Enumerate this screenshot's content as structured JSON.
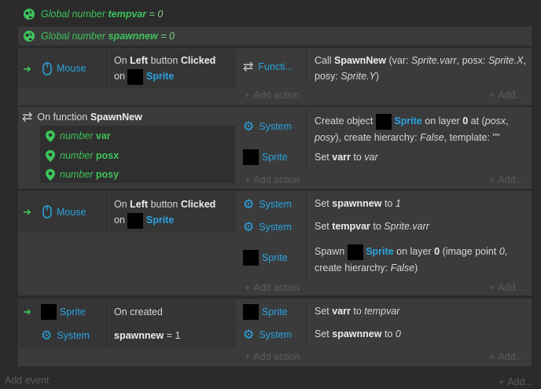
{
  "globals": [
    {
      "prefix": "Global number",
      "name": "tempvar",
      "value": "= 0"
    },
    {
      "prefix": "Global number",
      "name": "spawnnew",
      "value": "= 0"
    }
  ],
  "ev1": {
    "object": "Mouse",
    "cond_on": "On",
    "cond_btn": "Left",
    "cond_mid": "button",
    "cond_click": "Clicked",
    "cond_on2": "on",
    "cond_obj": "Sprite",
    "act_obj": "Functi...",
    "act_call": "Call",
    "act_fn": "SpawnNew",
    "act_args1": "(var:",
    "act_v1": "Sprite.varr",
    "act_args2": ", posx:",
    "act_v2": "Sprite.X",
    "act_args3": ",",
    "act_args4": "posy:",
    "act_v3": "Sprite.Y",
    "act_args5": ")"
  },
  "ev2": {
    "header_prefix": "On function",
    "header_name": "SpawnNew",
    "params": [
      {
        "type": "number",
        "name": "var"
      },
      {
        "type": "number",
        "name": "posx"
      },
      {
        "type": "number",
        "name": "posy"
      }
    ],
    "act1_obj": "System",
    "act1_a": "Create object",
    "act1_b": "Sprite",
    "act1_c": "on layer",
    "act1_d": "0",
    "act1_e": "at (",
    "act1_f": "posx",
    "act1_g": ",",
    "act1_h": "posy",
    "act1_i": "), create hierarchy:",
    "act1_j": "False",
    "act1_k": ", template: \"\"",
    "act2_obj": "Sprite",
    "act2_a": "Set",
    "act2_b": "varr",
    "act2_c": "to",
    "act2_d": "var"
  },
  "ev3": {
    "object": "Mouse",
    "cond_on": "On",
    "cond_btn": "Left",
    "cond_mid": "button",
    "cond_click": "Clicked",
    "cond_on2": "on",
    "cond_obj": "Sprite",
    "act1_obj": "System",
    "act1_a": "Set",
    "act1_b": "spawnnew",
    "act1_c": "to",
    "act1_d": "1",
    "act2_obj": "System",
    "act2_a": "Set",
    "act2_b": "tempvar",
    "act2_c": "to",
    "act2_d": "Sprite.varr",
    "act3_obj": "Sprite",
    "act3_a": "Spawn",
    "act3_b": "Sprite",
    "act3_c": "on layer",
    "act3_d": "0",
    "act3_e": "(image point",
    "act3_f": "0",
    "act3_g": ",",
    "act3_h": "create hierarchy:",
    "act3_i": "False",
    "act3_j": ")"
  },
  "ev4": {
    "cond1_obj": "Sprite",
    "cond1_text": "On created",
    "cond2_obj": "System",
    "cond2_var": "spawnnew",
    "cond2_rest": "= 1",
    "act1_obj": "Sprite",
    "act1_a": "Set",
    "act1_b": "varr",
    "act1_c": "to",
    "act1_d": "tempvar",
    "act2_obj": "System",
    "act2_a": "Set",
    "act2_b": "spawnnew",
    "act2_c": "to",
    "act2_d": "0"
  },
  "add_action": "Add action",
  "add_dots": "Add...",
  "add_event": "Add event",
  "colors": {
    "bg": "#2b2b2b",
    "block": "#3b3b3b",
    "cyan": "#2aa3df",
    "green": "#3ec45b"
  }
}
